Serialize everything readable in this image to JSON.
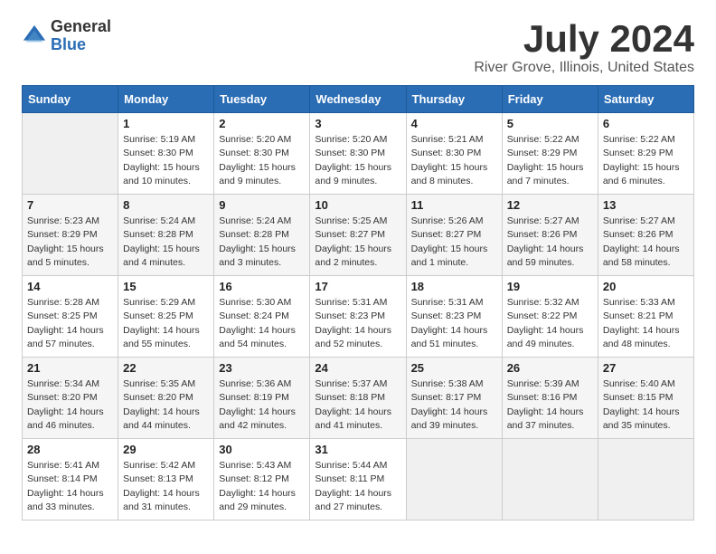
{
  "header": {
    "logo_general": "General",
    "logo_blue": "Blue",
    "month_title": "July 2024",
    "location": "River Grove, Illinois, United States"
  },
  "weekdays": [
    "Sunday",
    "Monday",
    "Tuesday",
    "Wednesday",
    "Thursday",
    "Friday",
    "Saturday"
  ],
  "weeks": [
    [
      {
        "day": "",
        "empty": true
      },
      {
        "day": "1",
        "sunrise": "Sunrise: 5:19 AM",
        "sunset": "Sunset: 8:30 PM",
        "daylight": "Daylight: 15 hours and 10 minutes."
      },
      {
        "day": "2",
        "sunrise": "Sunrise: 5:20 AM",
        "sunset": "Sunset: 8:30 PM",
        "daylight": "Daylight: 15 hours and 9 minutes."
      },
      {
        "day": "3",
        "sunrise": "Sunrise: 5:20 AM",
        "sunset": "Sunset: 8:30 PM",
        "daylight": "Daylight: 15 hours and 9 minutes."
      },
      {
        "day": "4",
        "sunrise": "Sunrise: 5:21 AM",
        "sunset": "Sunset: 8:30 PM",
        "daylight": "Daylight: 15 hours and 8 minutes."
      },
      {
        "day": "5",
        "sunrise": "Sunrise: 5:22 AM",
        "sunset": "Sunset: 8:29 PM",
        "daylight": "Daylight: 15 hours and 7 minutes."
      },
      {
        "day": "6",
        "sunrise": "Sunrise: 5:22 AM",
        "sunset": "Sunset: 8:29 PM",
        "daylight": "Daylight: 15 hours and 6 minutes."
      }
    ],
    [
      {
        "day": "7",
        "sunrise": "Sunrise: 5:23 AM",
        "sunset": "Sunset: 8:29 PM",
        "daylight": "Daylight: 15 hours and 5 minutes."
      },
      {
        "day": "8",
        "sunrise": "Sunrise: 5:24 AM",
        "sunset": "Sunset: 8:28 PM",
        "daylight": "Daylight: 15 hours and 4 minutes."
      },
      {
        "day": "9",
        "sunrise": "Sunrise: 5:24 AM",
        "sunset": "Sunset: 8:28 PM",
        "daylight": "Daylight: 15 hours and 3 minutes."
      },
      {
        "day": "10",
        "sunrise": "Sunrise: 5:25 AM",
        "sunset": "Sunset: 8:27 PM",
        "daylight": "Daylight: 15 hours and 2 minutes."
      },
      {
        "day": "11",
        "sunrise": "Sunrise: 5:26 AM",
        "sunset": "Sunset: 8:27 PM",
        "daylight": "Daylight: 15 hours and 1 minute."
      },
      {
        "day": "12",
        "sunrise": "Sunrise: 5:27 AM",
        "sunset": "Sunset: 8:26 PM",
        "daylight": "Daylight: 14 hours and 59 minutes."
      },
      {
        "day": "13",
        "sunrise": "Sunrise: 5:27 AM",
        "sunset": "Sunset: 8:26 PM",
        "daylight": "Daylight: 14 hours and 58 minutes."
      }
    ],
    [
      {
        "day": "14",
        "sunrise": "Sunrise: 5:28 AM",
        "sunset": "Sunset: 8:25 PM",
        "daylight": "Daylight: 14 hours and 57 minutes."
      },
      {
        "day": "15",
        "sunrise": "Sunrise: 5:29 AM",
        "sunset": "Sunset: 8:25 PM",
        "daylight": "Daylight: 14 hours and 55 minutes."
      },
      {
        "day": "16",
        "sunrise": "Sunrise: 5:30 AM",
        "sunset": "Sunset: 8:24 PM",
        "daylight": "Daylight: 14 hours and 54 minutes."
      },
      {
        "day": "17",
        "sunrise": "Sunrise: 5:31 AM",
        "sunset": "Sunset: 8:23 PM",
        "daylight": "Daylight: 14 hours and 52 minutes."
      },
      {
        "day": "18",
        "sunrise": "Sunrise: 5:31 AM",
        "sunset": "Sunset: 8:23 PM",
        "daylight": "Daylight: 14 hours and 51 minutes."
      },
      {
        "day": "19",
        "sunrise": "Sunrise: 5:32 AM",
        "sunset": "Sunset: 8:22 PM",
        "daylight": "Daylight: 14 hours and 49 minutes."
      },
      {
        "day": "20",
        "sunrise": "Sunrise: 5:33 AM",
        "sunset": "Sunset: 8:21 PM",
        "daylight": "Daylight: 14 hours and 48 minutes."
      }
    ],
    [
      {
        "day": "21",
        "sunrise": "Sunrise: 5:34 AM",
        "sunset": "Sunset: 8:20 PM",
        "daylight": "Daylight: 14 hours and 46 minutes."
      },
      {
        "day": "22",
        "sunrise": "Sunrise: 5:35 AM",
        "sunset": "Sunset: 8:20 PM",
        "daylight": "Daylight: 14 hours and 44 minutes."
      },
      {
        "day": "23",
        "sunrise": "Sunrise: 5:36 AM",
        "sunset": "Sunset: 8:19 PM",
        "daylight": "Daylight: 14 hours and 42 minutes."
      },
      {
        "day": "24",
        "sunrise": "Sunrise: 5:37 AM",
        "sunset": "Sunset: 8:18 PM",
        "daylight": "Daylight: 14 hours and 41 minutes."
      },
      {
        "day": "25",
        "sunrise": "Sunrise: 5:38 AM",
        "sunset": "Sunset: 8:17 PM",
        "daylight": "Daylight: 14 hours and 39 minutes."
      },
      {
        "day": "26",
        "sunrise": "Sunrise: 5:39 AM",
        "sunset": "Sunset: 8:16 PM",
        "daylight": "Daylight: 14 hours and 37 minutes."
      },
      {
        "day": "27",
        "sunrise": "Sunrise: 5:40 AM",
        "sunset": "Sunset: 8:15 PM",
        "daylight": "Daylight: 14 hours and 35 minutes."
      }
    ],
    [
      {
        "day": "28",
        "sunrise": "Sunrise: 5:41 AM",
        "sunset": "Sunset: 8:14 PM",
        "daylight": "Daylight: 14 hours and 33 minutes."
      },
      {
        "day": "29",
        "sunrise": "Sunrise: 5:42 AM",
        "sunset": "Sunset: 8:13 PM",
        "daylight": "Daylight: 14 hours and 31 minutes."
      },
      {
        "day": "30",
        "sunrise": "Sunrise: 5:43 AM",
        "sunset": "Sunset: 8:12 PM",
        "daylight": "Daylight: 14 hours and 29 minutes."
      },
      {
        "day": "31",
        "sunrise": "Sunrise: 5:44 AM",
        "sunset": "Sunset: 8:11 PM",
        "daylight": "Daylight: 14 hours and 27 minutes."
      },
      {
        "day": "",
        "empty": true
      },
      {
        "day": "",
        "empty": true
      },
      {
        "day": "",
        "empty": true
      }
    ]
  ]
}
